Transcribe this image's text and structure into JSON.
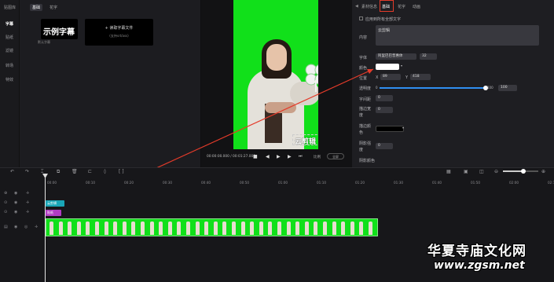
{
  "leftnav": {
    "title": "贴图库",
    "items": [
      {
        "label": "字幕",
        "active": true
      },
      {
        "label": "贴纸"
      },
      {
        "label": "滤镜"
      },
      {
        "label": "转场"
      },
      {
        "label": "特效"
      }
    ]
  },
  "library": {
    "tabs": [
      {
        "label": "基础",
        "active": true
      },
      {
        "label": "花字"
      }
    ],
    "sample_card": {
      "title": "示例字幕",
      "caption": "默认字幕"
    },
    "load_card": {
      "line1": "+ 读取字幕文件",
      "line2": "(支持srt/ass)"
    }
  },
  "player": {
    "subtitle": "云剪辑",
    "timecode": "00:00:00.000 / 00:01:27.000",
    "ratio_label": "比例",
    "fullscreen_label": "全屏"
  },
  "props": {
    "tabs": [
      {
        "label": "素材信息"
      },
      {
        "label": "基础",
        "active": true
      },
      {
        "label": "花字"
      },
      {
        "label": "动画"
      }
    ],
    "apply_all_label": "应用到所有全部文字",
    "content_label": "内容",
    "content_value": "云剪辑",
    "font_label": "字体",
    "font_value": "阿里巴巴普惠体",
    "font_size": "32",
    "color_label": "颜色",
    "color_value": "#ffffff",
    "position_label": "位置",
    "x_label": "X",
    "x_value": "89",
    "y_label": "Y",
    "y_value": "418",
    "opacity_label": "透明度",
    "opacity_min": "0",
    "opacity_max": "100",
    "opacity_value": "100",
    "opacity_fraction": 1.0,
    "spacing_label": "字间距",
    "spacing_value": "0",
    "stroke_label": "描边宽度",
    "stroke_value": "0",
    "stroke_color_label": "描边颜色",
    "stroke_color": "#000000",
    "shadow_label": "阴影强度",
    "shadow_value": "0",
    "shadow2_label": "阴影颜色"
  },
  "timeline": {
    "ruler": [
      "00:00",
      "00:10",
      "00:20",
      "00:30",
      "00:40",
      "00:50",
      "01:00",
      "01:10",
      "01:20",
      "01:30",
      "01:40",
      "01:50",
      "02:00",
      "02:10"
    ],
    "subtitle_clip": "云剪辑",
    "sticker_clip": "贴纸"
  },
  "watermark": {
    "line1": "华夏寺庙文化网",
    "line2": "www.zgsm.net"
  },
  "colors": {
    "accent": "#2f8ef0",
    "green_screen": "#11e01a",
    "highlight": "#e43b2a",
    "subtitle_clip": "#1aa6b7",
    "sticker_clip": "#b23cc4"
  }
}
